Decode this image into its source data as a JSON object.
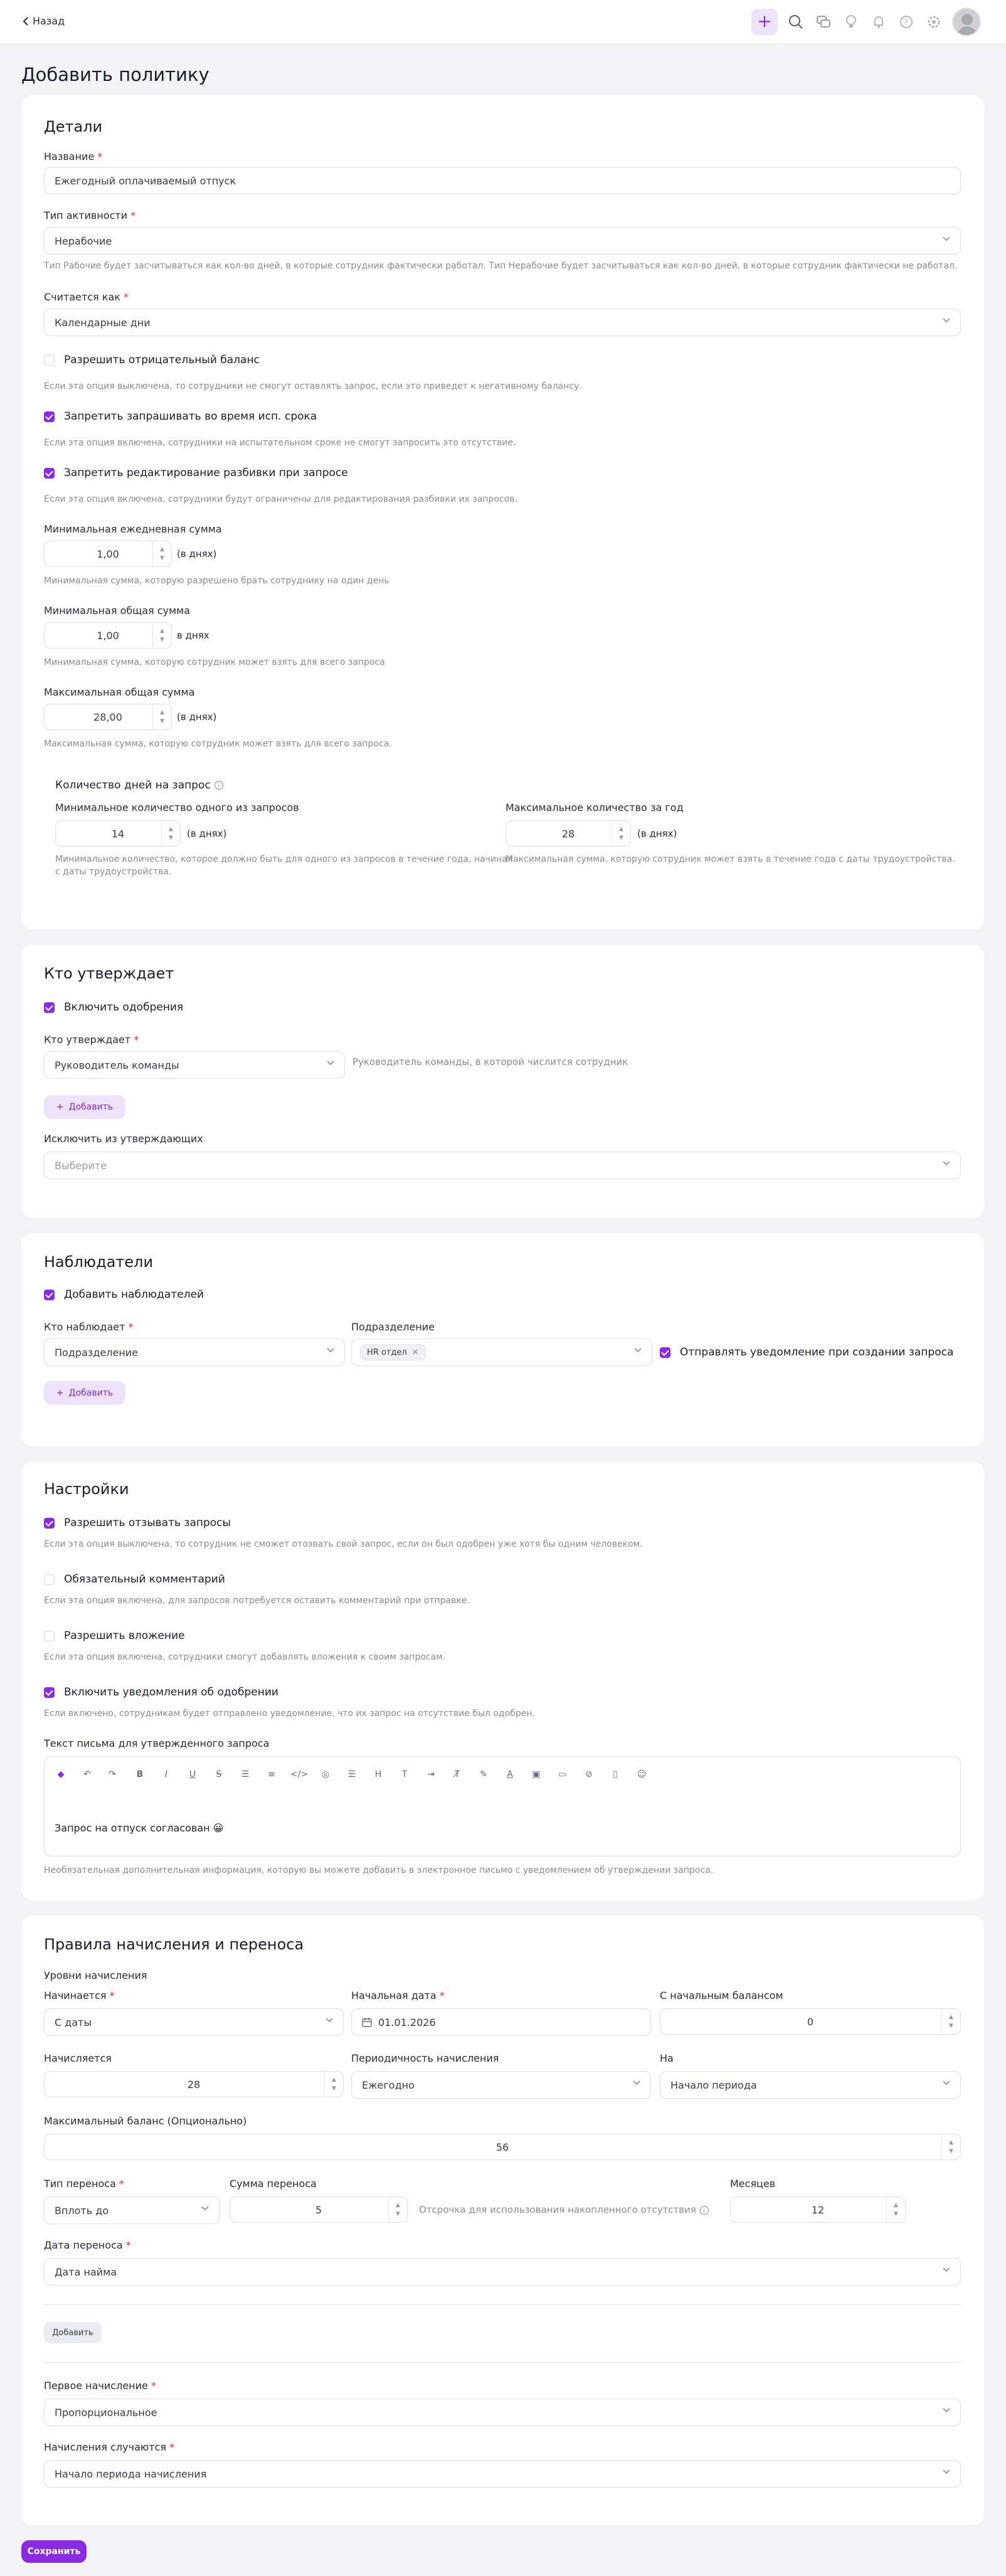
{
  "topbar": {
    "back_label": "Назад"
  },
  "page_title": "Добавить политику",
  "details": {
    "title": "Детали",
    "name_label": "Название",
    "name_value": "Ежегодный оплачиваемый отпуск",
    "activity_label": "Тип активности",
    "activity_value": "Нерабочие",
    "activity_hint": "Тип Рабочие будет засчитываться как кол-во дней, в которые сотрудник фактически работал. Тип Нерабочие будет засчитываться как кол-во дней, в которые сотрудник фактически не работал.",
    "counts_as_label": "Считается как",
    "counts_as_value": "Календарные дни",
    "allow_negative_label": "Разрешить отрицательный баланс",
    "allow_negative_hint": "Если эта опция выключена, то сотрудники не смогут оставлять запрос, если это приведет к негативному балансу.",
    "forbid_probation_label": "Запретить запрашивать во время исп. срока",
    "forbid_probation_hint": "Если эта опция включена, сотрудники на испытательном сроке не смогут запросить это отсутствие.",
    "forbid_split_label": "Запретить редактирование разбивки при запросе",
    "forbid_split_hint": "Если эта опция включена, сотрудники будут ограничены для редактирования разбивки их запросов.",
    "min_daily_label": "Минимальная ежедневная сумма",
    "min_daily_value": "1,00",
    "min_daily_unit": "(в днях)",
    "min_daily_hint": "Минимальная сумма, которую разрешено брать сотруднику на один день",
    "min_total_label": "Минимальная общая сумма",
    "min_total_value": "1,00",
    "min_total_unit": "в днях",
    "min_total_hint": "Минимальная сумма, которую сотрудник может взять для всего запроса",
    "max_total_label": "Максимальная общая сумма",
    "max_total_value": "28,00",
    "max_total_unit": "(в днях)",
    "max_total_hint": "Максимальная сумма, которую сотрудник может взять для всего запроса.",
    "days_per_request_label": "Количество дней на запрос",
    "min_one_label": "Минимальное количество одного из запросов",
    "min_one_value": "14",
    "min_one_unit": "(в днях)",
    "min_one_hint_1": "Минимальное количество, которое должно быть для одного из запросов в течение года, начиная",
    "min_one_hint_2": "с даты трудоустройства.",
    "max_year_label": "Максимальное количество за год",
    "max_year_value": "28",
    "max_year_unit": "(в днях)",
    "max_year_hint": "Максимальная сумма, которую сотрудник может взять в течение года с даты трудоустройства."
  },
  "approvers": {
    "title": "Кто утверждает",
    "enable_label": "Включить одобрения",
    "who_label": "Кто утверждает",
    "who_value": "Руководитель команды",
    "who_hint": "Руководитель команды, в которой числится сотрудник",
    "add_label": "Добавить",
    "exclude_label": "Исключить из утверждающих",
    "exclude_placeholder": "Выберите"
  },
  "observers": {
    "title": "Наблюдатели",
    "add_observers_label": "Добавить наблюдателей",
    "who_label": "Кто наблюдает",
    "who_value": "Подразделение",
    "dept_label": "Подразделение",
    "dept_tag": "HR отдел",
    "notify_label": "Отправлять уведомление при создании запроса",
    "add_label": "Добавить"
  },
  "settings": {
    "title": "Настройки",
    "revoke_label": "Разрешить отзывать запросы",
    "revoke_hint": "Если эта опция выключена, то сотрудник не сможет отозвать свой запрос, если он был одобрен уже хотя бы одним человеком.",
    "comment_label": "Обязательный комментарий",
    "comment_hint": "Если эта опция включена, для запросов потребуется оставить комментарий при отправке.",
    "attach_label": "Разрешить вложение",
    "attach_hint": "Если эта опция включена, сотрудники смогут добавлять вложения к своим запросам.",
    "notify_label": "Включить уведомления об одобрении",
    "notify_hint": "Если включено, сотрудникам будет отправлено уведомление, что их запрос на отсутствие был одобрен.",
    "email_label": "Текст письма для утвержденного запроса",
    "email_body": "Запрос на отпуск согласован 😀",
    "email_hint": "Необязательная дополнительная информация, которую вы можете добавить в электронное письмо с уведомлением об утверждении запроса."
  },
  "accrual": {
    "title": "Правила начисления и переноса",
    "levels_label": "Уровни начисления",
    "starts_label": "Начинается",
    "starts_value": "С даты",
    "start_date_label": "Начальная дата",
    "start_date_value": "01.01.2026",
    "start_balance_label": "С начальным балансом",
    "start_balance_value": "0",
    "accrues_label": "Начисляется",
    "accrues_value": "28",
    "periodicity_label": "Периодичность начисления",
    "periodicity_value": "Ежегодно",
    "on_label": "На",
    "on_value": "Начало периода",
    "max_balance_label": "Максимальный баланс (Опционально)",
    "max_balance_value": "56",
    "carry_type_label": "Тип переноса",
    "carry_type_value": "Вплоть до",
    "carry_sum_label": "Сумма переноса",
    "carry_sum_value": "5",
    "defer_label": "Отсрочка для использования накопленного отсутствия",
    "months_label": "Месяцев",
    "months_value": "12",
    "carry_date_label": "Дата переноса",
    "carry_date_value": "Дата найма",
    "add_label": "Добавить",
    "first_accrual_label": "Первое начисление",
    "first_accrual_value": "Пропорциональное",
    "accruals_happen_label": "Начисления случаются",
    "accruals_happen_value": "Начало периода начисления"
  },
  "save_label": "Сохранить"
}
